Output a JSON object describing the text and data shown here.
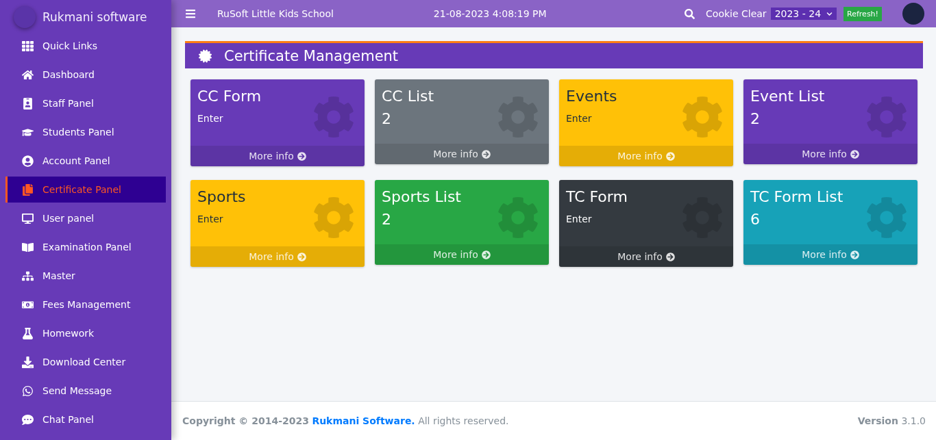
{
  "brand": {
    "name": "Rukmani software"
  },
  "sidebar": {
    "items": [
      {
        "label": "Quick Links",
        "selected": false
      },
      {
        "label": "Dashboard",
        "selected": false
      },
      {
        "label": "Staff Panel",
        "selected": false
      },
      {
        "label": "Students Panel",
        "selected": false
      },
      {
        "label": "Account Panel",
        "selected": false
      },
      {
        "label": "Certificate Panel",
        "selected": true
      },
      {
        "label": "User panel",
        "selected": false
      },
      {
        "label": "Examination Panel",
        "selected": false
      },
      {
        "label": "Master",
        "selected": false
      },
      {
        "label": "Fees Management",
        "selected": false
      },
      {
        "label": "Homework",
        "selected": false
      },
      {
        "label": "Download Center",
        "selected": false
      },
      {
        "label": "Send Message",
        "selected": false
      },
      {
        "label": "Chat Panel",
        "selected": false
      }
    ]
  },
  "topbar": {
    "school": "RuSoft Little Kids School",
    "datetime": "21-08-2023 4:08:19 PM",
    "cookie_clear": "Cookie Clear",
    "session": "2023 - 24",
    "refresh": "Refresh!"
  },
  "page": {
    "title": "Certificate Management"
  },
  "cards": [
    {
      "title": "CC Form",
      "kind": "enter",
      "value": "Enter",
      "color": "#673ab7",
      "link": "More info"
    },
    {
      "title": "CC List",
      "kind": "count",
      "value": "2",
      "color": "#6c757d",
      "link": "More info"
    },
    {
      "title": "Events",
      "kind": "enter",
      "value": "Enter",
      "color": "#ffc107",
      "link": "More info"
    },
    {
      "title": "Event List",
      "kind": "count",
      "value": "2",
      "color": "#673ab7",
      "link": "More info"
    },
    {
      "title": "Sports",
      "kind": "enter",
      "value": "Enter",
      "color": "#ffc107",
      "link": "More info"
    },
    {
      "title": "Sports List",
      "kind": "count",
      "value": "2",
      "color": "#28a745",
      "link": "More info"
    },
    {
      "title": "TC Form",
      "kind": "enter",
      "value": "Enter",
      "color": "#343a40",
      "link": "More info"
    },
    {
      "title": "TC Form List",
      "kind": "count",
      "value": "6",
      "color": "#17a2b8",
      "link": "More info"
    }
  ],
  "footer": {
    "copyright": "Copyright © 2014-2023",
    "link": "Rukmani Software.",
    "rights": "All rights reserved.",
    "version_label": "Version",
    "version": "3.1.0"
  }
}
